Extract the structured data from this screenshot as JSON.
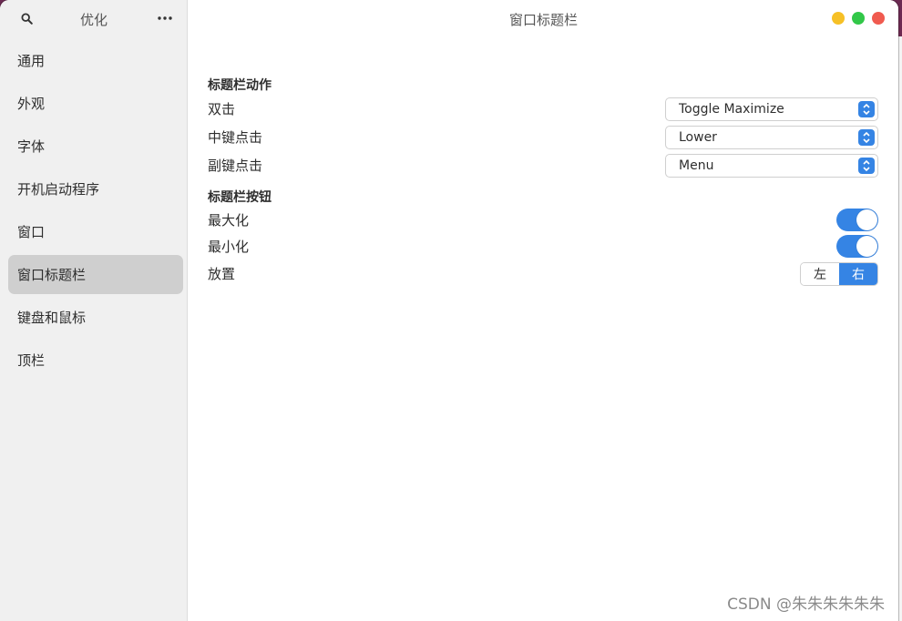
{
  "sidebar": {
    "title": "优化",
    "items": [
      {
        "label": "通用"
      },
      {
        "label": "外观"
      },
      {
        "label": "字体"
      },
      {
        "label": "开机启动程序"
      },
      {
        "label": "窗口"
      },
      {
        "label": "窗口标题栏",
        "active": true
      },
      {
        "label": "键盘和鼠标"
      },
      {
        "label": "顶栏"
      }
    ]
  },
  "main": {
    "title": "窗口标题栏",
    "actions": {
      "heading": "标题栏动作",
      "double_click": {
        "label": "双击",
        "value": "Toggle Maximize"
      },
      "middle_click": {
        "label": "中键点击",
        "value": "Lower"
      },
      "secondary_click": {
        "label": "副键点击",
        "value": "Menu"
      }
    },
    "buttons": {
      "heading": "标题栏按钮",
      "maximize": {
        "label": "最大化",
        "enabled": true
      },
      "minimize": {
        "label": "最小化",
        "enabled": true
      },
      "placement": {
        "label": "放置",
        "options": [
          "左",
          "右"
        ],
        "selected": "右"
      }
    }
  },
  "watermark": "CSDN @朱朱朱朱朱朱",
  "colors": {
    "accent": "#3584e4",
    "close": "#f05a4f",
    "maximize": "#32c748",
    "minimize": "#f6c026"
  }
}
